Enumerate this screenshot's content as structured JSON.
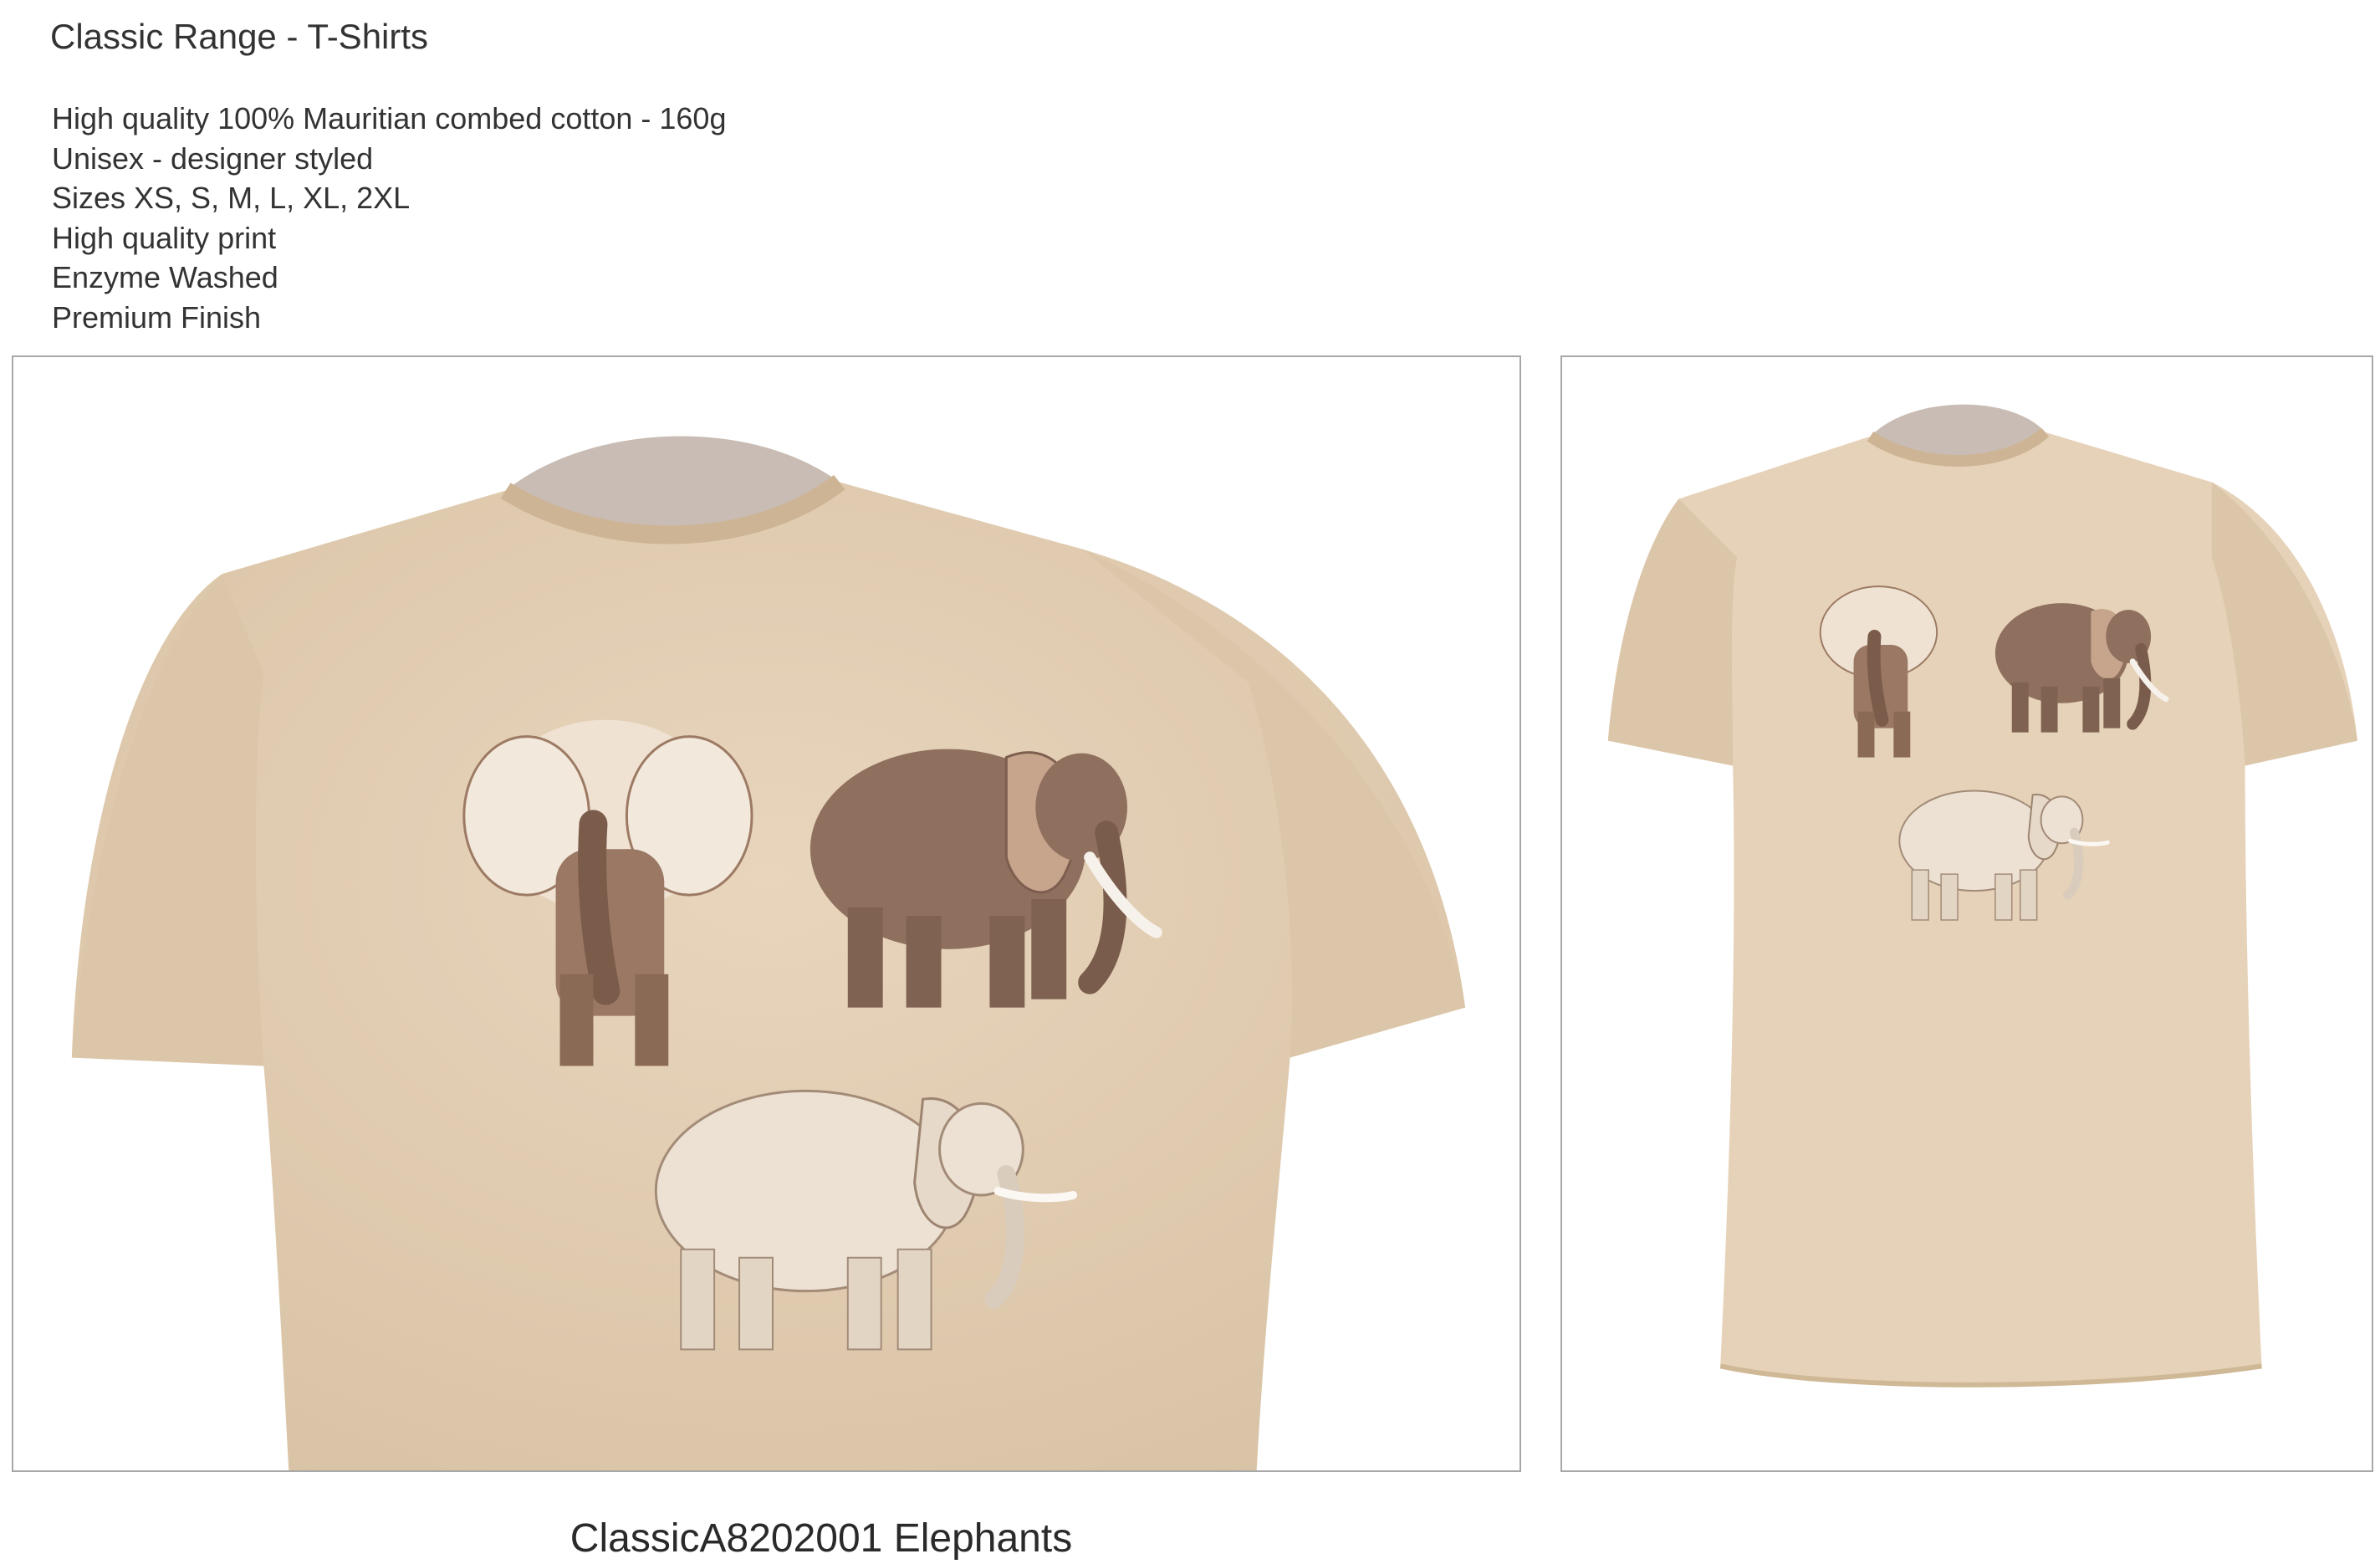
{
  "header": {
    "title": "Classic Range - T-Shirts"
  },
  "specs": [
    "High quality 100% Mauritian combed cotton - 160g",
    "Unisex - designer styled",
    "Sizes XS, S, M, L, XL, 2XL",
    "High quality print",
    "Enzyme Washed",
    "Premium Finish"
  ],
  "product": {
    "caption": "ClassicA8202001 Elephants"
  },
  "colors": {
    "shirt": "#e6d2b8",
    "shirt_shadow": "#d2bb9d",
    "inner_collar": "#c9bcb4",
    "elephant_brown": "#8a6a55",
    "elephant_light": "#eee3d6",
    "frame_border": "#a8a8a8"
  },
  "images": {
    "front_view": "elephants-tshirt-closeup",
    "full_view": "elephants-tshirt-full"
  }
}
